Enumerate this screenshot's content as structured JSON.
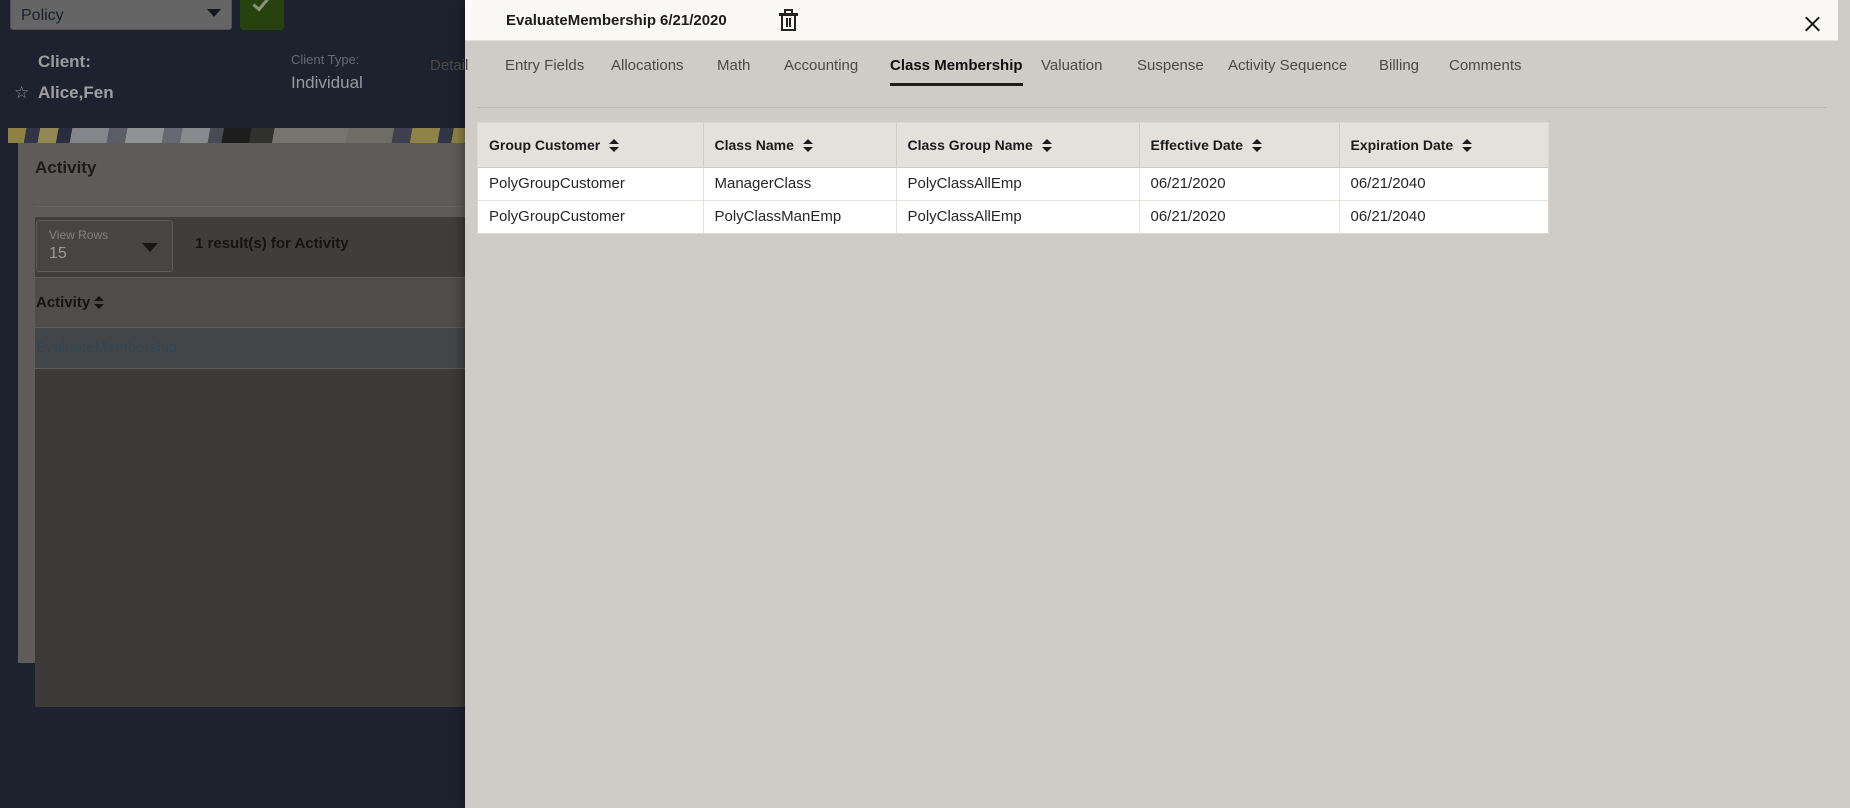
{
  "background": {
    "policy_select": {
      "value": "Policy",
      "caret_icon": "chevron-down-icon"
    },
    "confirm_button": {
      "icon": "check-icon"
    },
    "client": {
      "label": "Client:",
      "name": "Alice,Fen",
      "favorite_icon": "star-icon",
      "type_label": "Client Type:",
      "type_value": "Individual"
    },
    "panel": {
      "title": "Activity",
      "view_rows_label": "View Rows",
      "view_rows_value": "15",
      "results_text": "1 result(s) for Activity",
      "grid_header": "Activity",
      "sort_icon": "sort-chevrons-icon",
      "selected_row": "EvaluateMembership"
    }
  },
  "modal": {
    "header": {
      "title": "EvaluateMembership",
      "date": "6/21/2020",
      "delete_icon": "trash-icon",
      "close_icon": "close-icon"
    },
    "tabs": [
      {
        "label": "Detail",
        "active": false
      },
      {
        "label": "Entry Fields",
        "active": false
      },
      {
        "label": "Allocations",
        "active": false
      },
      {
        "label": "Math",
        "active": false
      },
      {
        "label": "Accounting",
        "active": false
      },
      {
        "label": "Class Membership",
        "active": true
      },
      {
        "label": "Valuation",
        "active": false
      },
      {
        "label": "Suspense",
        "active": false
      },
      {
        "label": "Activity Sequence",
        "active": false
      },
      {
        "label": "Billing",
        "active": false
      },
      {
        "label": "Comments",
        "active": false
      }
    ],
    "table": {
      "sort_icon": "sort-chevrons-icon",
      "columns": [
        "Group Customer",
        "Class Name",
        "Class Group Name",
        "Effective Date",
        "Expiration Date"
      ],
      "rows": [
        [
          "PolyGroupCustomer",
          "ManagerClass",
          "PolyClassAllEmp",
          "06/21/2020",
          "06/21/2040"
        ],
        [
          "PolyGroupCustomer",
          "PolyClassManEmp",
          "PolyClassAllEmp",
          "06/21/2020",
          "06/21/2040"
        ]
      ]
    }
  },
  "colors": {
    "app_navy": "#2e3347",
    "modal_bg": "#cfcbc6",
    "header_bg": "#faf9f7",
    "accent_green": "#3a6617",
    "table_header_bg": "#e4e1dc"
  }
}
